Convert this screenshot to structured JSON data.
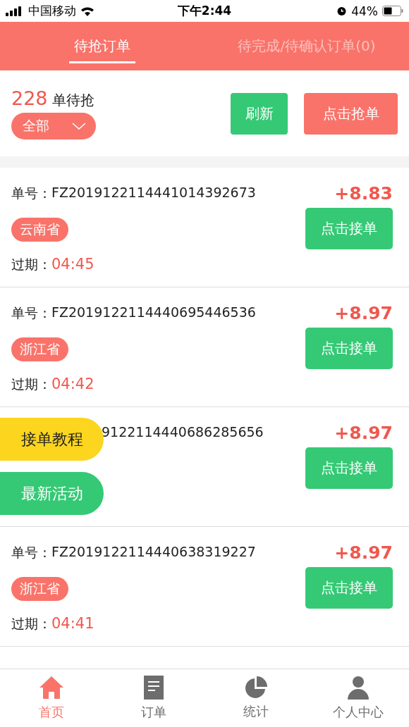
{
  "status_bar": {
    "carrier": "中国移动",
    "time": "下午2:44",
    "battery_percent": "44%"
  },
  "tabs": [
    {
      "label": "待抢订单",
      "selected": true
    },
    {
      "label": "待完成/待确认订单(0)",
      "selected": false
    }
  ],
  "summary": {
    "count": "228",
    "count_label": "单待抢",
    "filter": "全部",
    "refresh_button": "刷新",
    "grab_button": "点击抢单"
  },
  "orders": [
    {
      "kind": "full",
      "label": "单号：",
      "order_no": "FZ2019122114441014392673",
      "province": "云南省",
      "price": "+8.83",
      "action": "点击接单",
      "expiry_label": "过期：",
      "expiry": "04:45"
    },
    {
      "kind": "full",
      "label": "单号：",
      "order_no": "FZ2019122114440695446536",
      "province": "浙江省",
      "price": "+8.97",
      "action": "点击接单",
      "expiry_label": "过期：",
      "expiry": "04:42"
    },
    {
      "kind": "covered",
      "order_no": "9122114440686285656",
      "price": "+8.97",
      "action": "点击接单"
    },
    {
      "kind": "full",
      "label": "单号：",
      "order_no": "FZ2019122114440638319227",
      "province": "浙江省",
      "price": "+8.97",
      "action": "点击接单",
      "expiry_label": "过期：",
      "expiry": "04:41"
    }
  ],
  "floating_buttons": [
    {
      "kind": "tutorial",
      "label": "接单教程"
    },
    {
      "kind": "activity",
      "label": "最新活动"
    }
  ],
  "bottom_nav": [
    {
      "kind": "home",
      "label": "首页",
      "selected": true
    },
    {
      "kind": "document",
      "label": "订单",
      "selected": false
    },
    {
      "kind": "chart",
      "label": "统计",
      "selected": false
    },
    {
      "kind": "person",
      "label": "个人中心",
      "selected": false
    }
  ]
}
